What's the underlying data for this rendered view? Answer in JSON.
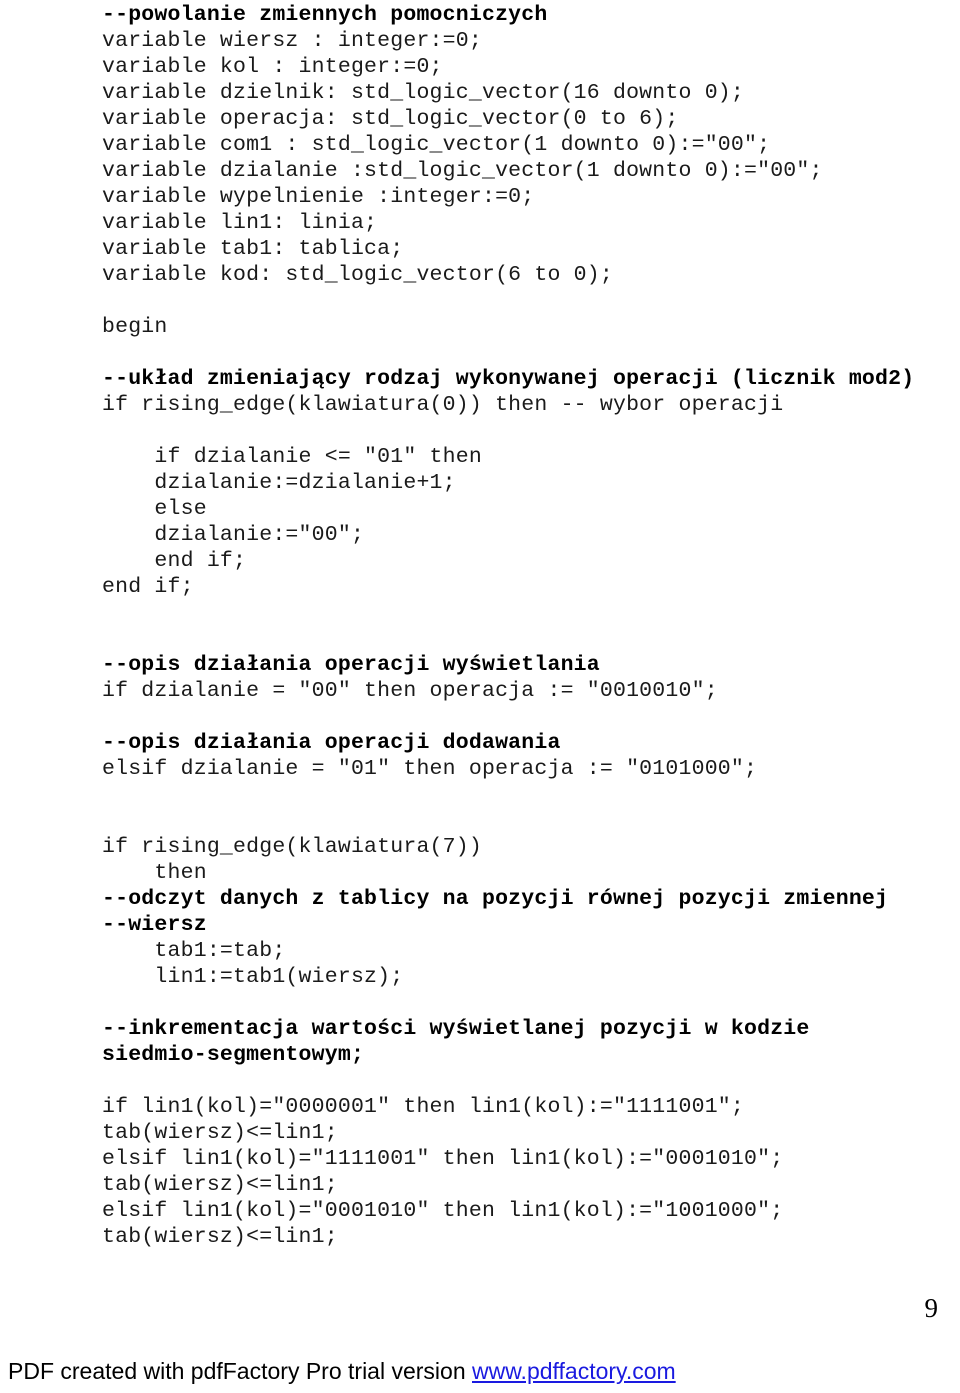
{
  "document": {
    "page_number": "9",
    "code_lines": [
      {
        "text": "--powolanie zmiennych pomocniczych",
        "bold": true
      },
      {
        "text": "variable wiersz : integer:=0;",
        "bold": false
      },
      {
        "text": "variable kol : integer:=0;",
        "bold": false
      },
      {
        "text": "variable dzielnik: std_logic_vector(16 downto 0);",
        "bold": false
      },
      {
        "text": "variable operacja: std_logic_vector(0 to 6);",
        "bold": false
      },
      {
        "text": "variable com1 : std_logic_vector(1 downto 0):=\"00\";",
        "bold": false
      },
      {
        "text": "variable dzialanie :std_logic_vector(1 downto 0):=\"00\";",
        "bold": false
      },
      {
        "text": "variable wypelnienie :integer:=0;",
        "bold": false
      },
      {
        "text": "variable lin1: linia;",
        "bold": false
      },
      {
        "text": "variable tab1: tablica;",
        "bold": false
      },
      {
        "text": "variable kod: std_logic_vector(6 to 0);",
        "bold": false
      },
      {
        "text": "",
        "bold": false
      },
      {
        "text": "begin",
        "bold": false
      },
      {
        "text": "",
        "bold": false
      },
      {
        "text": "--układ zmieniający rodzaj wykonywanej operacji (licznik mod2)",
        "bold": true
      },
      {
        "text": "if rising_edge(klawiatura(0)) then -- wybor operacji",
        "bold": false
      },
      {
        "text": "",
        "bold": false
      },
      {
        "text": "    if dzialanie <= \"01\" then",
        "bold": false
      },
      {
        "text": "    dzialanie:=dzialanie+1;",
        "bold": false
      },
      {
        "text": "    else",
        "bold": false
      },
      {
        "text": "    dzialanie:=\"00\";",
        "bold": false
      },
      {
        "text": "    end if;",
        "bold": false
      },
      {
        "text": "end if;",
        "bold": false
      },
      {
        "text": "",
        "bold": false
      },
      {
        "text": "",
        "bold": false
      },
      {
        "text": "--opis działania operacji wyświetlania",
        "bold": true
      },
      {
        "text": "if dzialanie = \"00\" then operacja := \"0010010\";",
        "bold": false
      },
      {
        "text": "",
        "bold": false
      },
      {
        "text": "--opis działania operacji dodawania",
        "bold": true
      },
      {
        "text": "elsif dzialanie = \"01\" then operacja := \"0101000\";",
        "bold": false
      },
      {
        "text": "",
        "bold": false
      },
      {
        "text": "",
        "bold": false
      },
      {
        "text": "if rising_edge(klawiatura(7))",
        "bold": false
      },
      {
        "text": "    then",
        "bold": false
      },
      {
        "text": "--odczyt danych z tablicy na pozycji równej pozycji zmiennej",
        "bold": true
      },
      {
        "text": "--wiersz",
        "bold": true
      },
      {
        "text": "    tab1:=tab;",
        "bold": false
      },
      {
        "text": "    lin1:=tab1(wiersz);",
        "bold": false
      },
      {
        "text": "",
        "bold": false
      },
      {
        "text": "--inkrementacja wartości wyświetlanej pozycji w kodzie",
        "bold": true
      },
      {
        "text": "siedmio-segmentowym;",
        "bold": true
      },
      {
        "text": "",
        "bold": false
      },
      {
        "text": "if lin1(kol)=\"0000001\" then lin1(kol):=\"1111001\";",
        "bold": false
      },
      {
        "text": "tab(wiersz)<=lin1;",
        "bold": false
      },
      {
        "text": "elsif lin1(kol)=\"1111001\" then lin1(kol):=\"0001010\";",
        "bold": false
      },
      {
        "text": "tab(wiersz)<=lin1;",
        "bold": false
      },
      {
        "text": "elsif lin1(kol)=\"0001010\" then lin1(kol):=\"1001000\";",
        "bold": false
      },
      {
        "text": "tab(wiersz)<=lin1;",
        "bold": false
      }
    ]
  },
  "footer": {
    "text": "PDF created with pdfFactory Pro trial version ",
    "link_text": "www.pdffactory.com",
    "link_color": "#1a1ae0"
  }
}
